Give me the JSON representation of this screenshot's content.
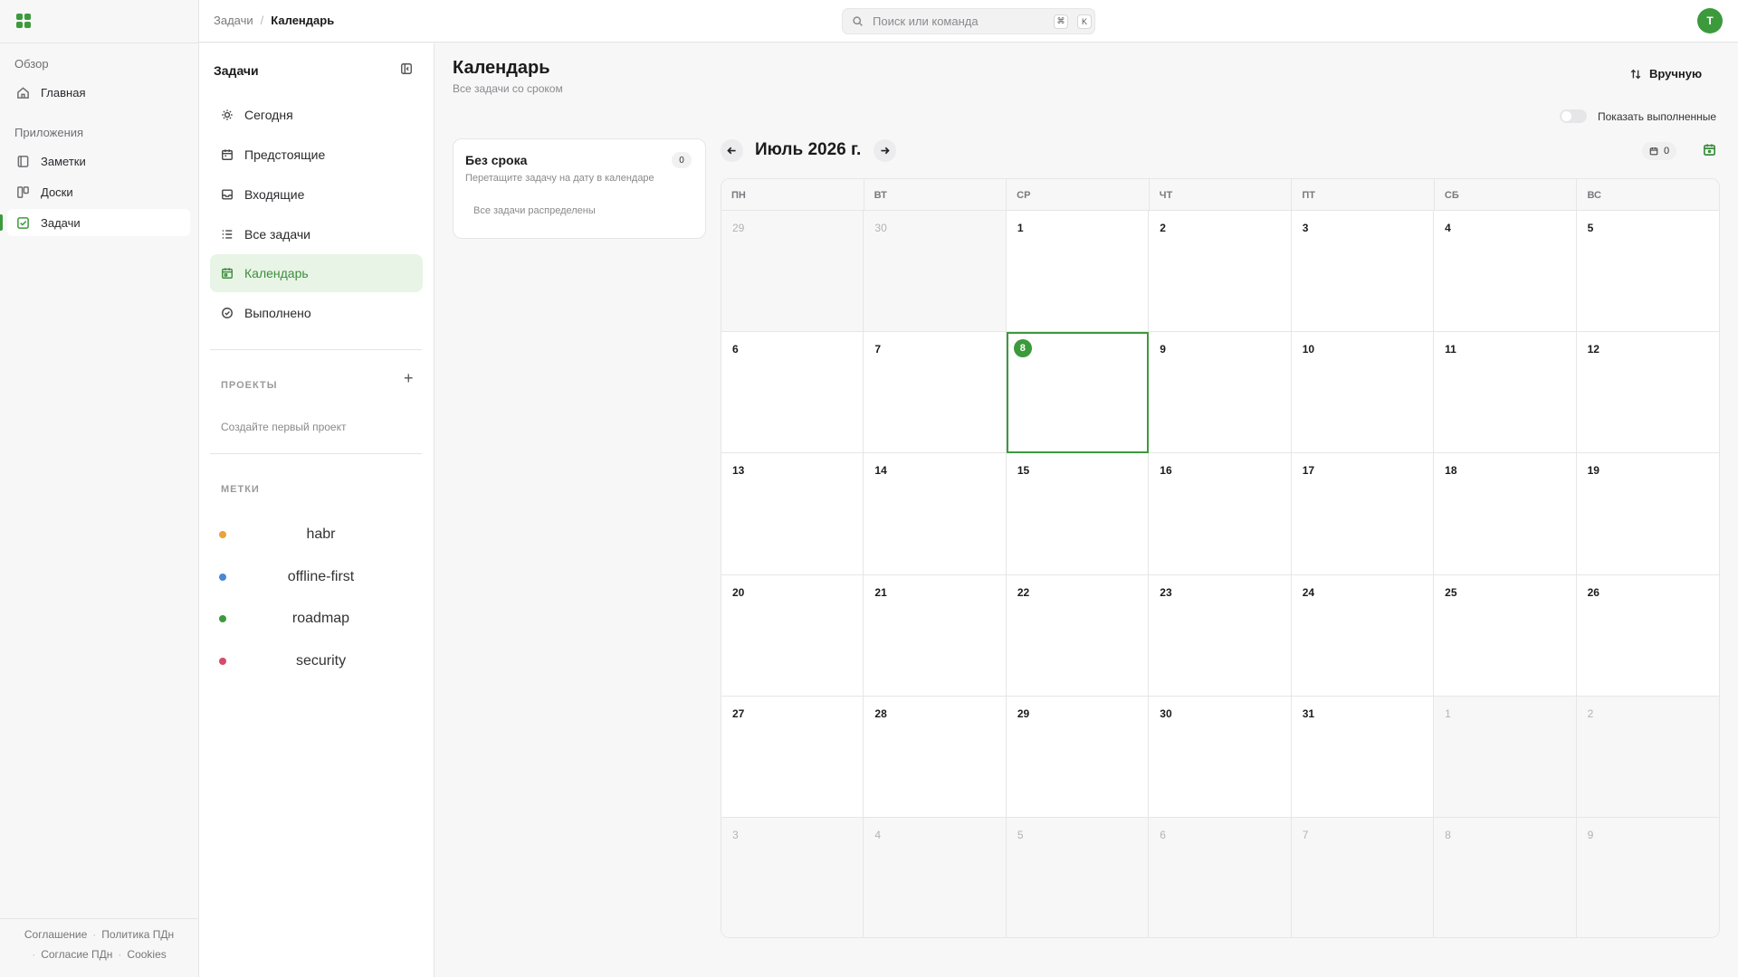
{
  "app": {
    "nav": {
      "overview_label": "Обзор",
      "home_label": "Главная",
      "apps_label": "Приложения",
      "items": [
        {
          "label": "Заметки",
          "icon": "notes-icon"
        },
        {
          "label": "Доски",
          "icon": "boards-icon"
        },
        {
          "label": "Задачи",
          "icon": "tasks-icon"
        }
      ],
      "active": "Задачи"
    },
    "footer": {
      "agreement": "Соглашение",
      "privacy": "Политика ПДн",
      "consent": "Согласие ПДн",
      "cookies": "Cookies"
    }
  },
  "topbar": {
    "breadcrumb_parent": "Задачи",
    "breadcrumb_current": "Календарь",
    "search_placeholder": "Поиск или команда",
    "search_kbd_1": "⌘",
    "search_kbd_2": "K",
    "avatar_initial": "T"
  },
  "tasks_panel": {
    "title": "Задачи",
    "items": [
      {
        "label": "Сегодня",
        "icon": "sun-icon"
      },
      {
        "label": "Предстоящие",
        "icon": "calendar-upcoming-icon"
      },
      {
        "label": "Входящие",
        "icon": "inbox-icon"
      },
      {
        "label": "Все задачи",
        "icon": "list-icon"
      },
      {
        "label": "Календарь",
        "icon": "calendar-icon"
      },
      {
        "label": "Выполнено",
        "icon": "check-circle-icon"
      }
    ],
    "active": "Календарь",
    "projects_label": "ПРОЕКТЫ",
    "projects_empty": "Создайте первый проект",
    "tags_label": "МЕТКИ",
    "tags": [
      {
        "label": "habr",
        "color": "#e8a33a"
      },
      {
        "label": "offline-first",
        "color": "#4a86d8"
      },
      {
        "label": "roadmap",
        "color": "#3c9a3c"
      },
      {
        "label": "security",
        "color": "#d8496a"
      }
    ]
  },
  "main": {
    "title": "Календарь",
    "subtitle": "Все задачи со сроком",
    "sort_label": "Вручную",
    "show_done_label": "Показать выполненные",
    "show_done": false
  },
  "no_date": {
    "title": "Без срока",
    "count": "0",
    "hint": "Перетащите задачу на дату в календаре",
    "empty": "Все задачи распределены"
  },
  "calendar": {
    "month_label": "Июль 2026 г.",
    "task_count": "0",
    "weekdays": [
      "ПН",
      "ВТ",
      "СР",
      "ЧТ",
      "ПТ",
      "СБ",
      "ВС"
    ],
    "today": 8,
    "cells": [
      {
        "d": "29",
        "out": true
      },
      {
        "d": "30",
        "out": true
      },
      {
        "d": "1"
      },
      {
        "d": "2"
      },
      {
        "d": "3"
      },
      {
        "d": "4"
      },
      {
        "d": "5"
      },
      {
        "d": "6"
      },
      {
        "d": "7"
      },
      {
        "d": "8"
      },
      {
        "d": "9"
      },
      {
        "d": "10"
      },
      {
        "d": "11"
      },
      {
        "d": "12"
      },
      {
        "d": "13"
      },
      {
        "d": "14"
      },
      {
        "d": "15"
      },
      {
        "d": "16"
      },
      {
        "d": "17"
      },
      {
        "d": "18"
      },
      {
        "d": "19"
      },
      {
        "d": "20"
      },
      {
        "d": "21"
      },
      {
        "d": "22"
      },
      {
        "d": "23"
      },
      {
        "d": "24"
      },
      {
        "d": "25"
      },
      {
        "d": "26"
      },
      {
        "d": "27"
      },
      {
        "d": "28"
      },
      {
        "d": "29"
      },
      {
        "d": "30"
      },
      {
        "d": "31"
      },
      {
        "d": "1",
        "out": true
      },
      {
        "d": "2",
        "out": true
      },
      {
        "d": "3",
        "out": true
      },
      {
        "d": "4",
        "out": true
      },
      {
        "d": "5",
        "out": true
      },
      {
        "d": "6",
        "out": true
      },
      {
        "d": "7",
        "out": true
      },
      {
        "d": "8",
        "out": true
      },
      {
        "d": "9",
        "out": true
      }
    ]
  }
}
